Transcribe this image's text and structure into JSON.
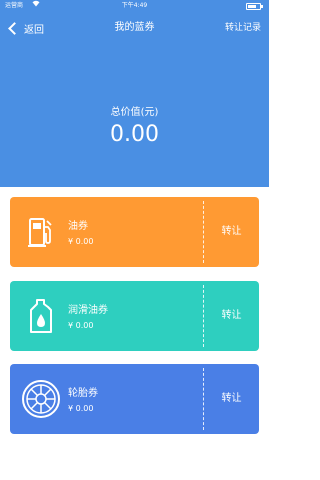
{
  "status_bar": {
    "carrier": "运营商",
    "time": "下午4:49",
    "battery_level": 0.75
  },
  "nav": {
    "back_label": "返回",
    "title": "我的蓝券",
    "right_label": "转让记录"
  },
  "summary": {
    "label": "总价值(元)",
    "value": "0.00"
  },
  "colors": {
    "header": "#4a8fe3",
    "card_fuel": "#ff9a33",
    "card_lube": "#2ecfbf",
    "card_tire": "#4a7fe6"
  },
  "cards": [
    {
      "name": "油券",
      "amount": "¥ 0.00",
      "action": "转让",
      "icon": "fuel-pump-icon"
    },
    {
      "name": "润滑油券",
      "amount": "¥ 0.00",
      "action": "转让",
      "icon": "oil-bottle-icon"
    },
    {
      "name": "轮胎券",
      "amount": "¥ 0.00",
      "action": "转让",
      "icon": "tire-icon"
    }
  ]
}
